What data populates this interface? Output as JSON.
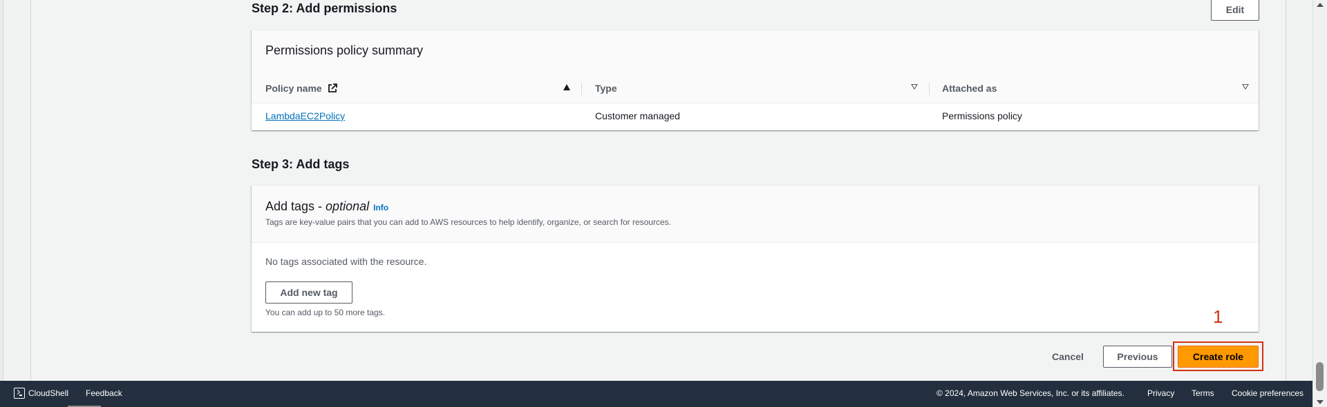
{
  "step2": {
    "title": "Step 2: Add permissions",
    "edit_label": "Edit",
    "card_title": "Permissions policy summary",
    "columns": [
      "Policy name",
      "Type",
      "Attached as"
    ],
    "rows": [
      {
        "policy_name": "LambdaEC2Policy",
        "type": "Customer managed",
        "attached_as": "Permissions policy"
      }
    ]
  },
  "step3": {
    "title": "Step 3: Add tags",
    "card_title": "Add tags - ",
    "card_title_optional": "optional",
    "info_label": "Info",
    "description": "Tags are key-value pairs that you can add to AWS resources to help identify, organize, or search for resources.",
    "empty_text": "No tags associated with the resource.",
    "add_tag_label": "Add new tag",
    "limit_text": "You can add up to 50 more tags."
  },
  "actions": {
    "cancel_label": "Cancel",
    "previous_label": "Previous",
    "create_label": "Create role"
  },
  "annotation": {
    "number": "1",
    "color": "#d13212"
  },
  "footer": {
    "cloudshell_label": "CloudShell",
    "feedback_label": "Feedback",
    "copyright": "© 2024, Amazon Web Services, Inc. or its affiliates.",
    "privacy_label": "Privacy",
    "terms_label": "Terms",
    "cookie_label": "Cookie preferences"
  },
  "colors": {
    "primary": "#ff9900",
    "link": "#0073bb",
    "footer_bg": "#232f3e"
  },
  "icons": [
    "external-link-icon",
    "sort-ascending-icon",
    "sort-icon",
    "cloudshell-icon"
  ]
}
